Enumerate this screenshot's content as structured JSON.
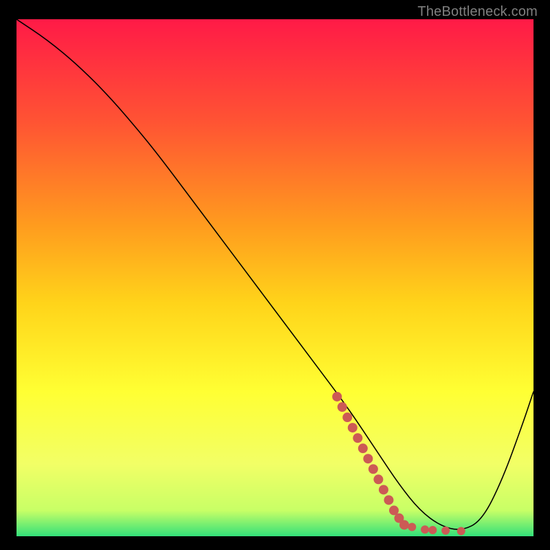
{
  "watermark": "TheBottleneck.com",
  "chart_data": {
    "type": "line",
    "title": "",
    "xlabel": "",
    "ylabel": "",
    "xlim": [
      0,
      100
    ],
    "ylim": [
      0,
      100
    ],
    "grid": false,
    "legend": false,
    "gradient_bg": {
      "direction": "vertical",
      "stops": [
        {
          "pos": 0.0,
          "color": "#ff1a47"
        },
        {
          "pos": 0.2,
          "color": "#ff5433"
        },
        {
          "pos": 0.4,
          "color": "#ff9c1e"
        },
        {
          "pos": 0.55,
          "color": "#ffd41a"
        },
        {
          "pos": 0.72,
          "color": "#ffff33"
        },
        {
          "pos": 0.86,
          "color": "#f2ff66"
        },
        {
          "pos": 0.95,
          "color": "#c8ff66"
        },
        {
          "pos": 1.0,
          "color": "#33e07a"
        }
      ]
    },
    "series": [
      {
        "name": "bottleneck-curve",
        "color": "#000000",
        "width": 1.6,
        "x": [
          0,
          6,
          12,
          18,
          24,
          28,
          34,
          40,
          46,
          52,
          58,
          64,
          70,
          74,
          78,
          82,
          86,
          90,
          94,
          98,
          100
        ],
        "y": [
          100,
          96,
          91,
          85,
          78,
          73,
          65,
          57,
          49,
          41,
          33,
          25,
          16,
          10,
          5,
          2,
          1,
          3,
          11,
          22,
          28
        ]
      }
    ],
    "scatter_overlay": {
      "name": "highlight-points",
      "color": "#cc5a55",
      "points": [
        {
          "x": 62,
          "y": 27,
          "r": 7
        },
        {
          "x": 63,
          "y": 25,
          "r": 7
        },
        {
          "x": 64,
          "y": 23,
          "r": 7
        },
        {
          "x": 65,
          "y": 21,
          "r": 7
        },
        {
          "x": 66,
          "y": 19,
          "r": 7
        },
        {
          "x": 67,
          "y": 17,
          "r": 7
        },
        {
          "x": 68,
          "y": 15,
          "r": 7
        },
        {
          "x": 69,
          "y": 13,
          "r": 7
        },
        {
          "x": 70,
          "y": 11,
          "r": 7
        },
        {
          "x": 71,
          "y": 9,
          "r": 7
        },
        {
          "x": 72,
          "y": 7,
          "r": 7
        },
        {
          "x": 73,
          "y": 5,
          "r": 7
        },
        {
          "x": 74,
          "y": 3.5,
          "r": 7
        },
        {
          "x": 75,
          "y": 2.2,
          "r": 7
        },
        {
          "x": 76.5,
          "y": 1.8,
          "r": 6
        },
        {
          "x": 79,
          "y": 1.3,
          "r": 6
        },
        {
          "x": 80.5,
          "y": 1.2,
          "r": 6
        },
        {
          "x": 83,
          "y": 1.1,
          "r": 6
        },
        {
          "x": 86,
          "y": 1.0,
          "r": 6
        }
      ]
    }
  }
}
